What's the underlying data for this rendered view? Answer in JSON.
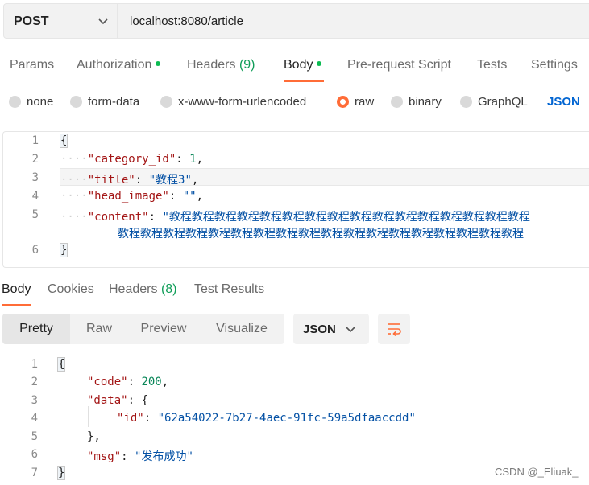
{
  "request": {
    "method": "POST",
    "url": "localhost:8080/article"
  },
  "request_tabs": [
    {
      "label": "Params",
      "dot": false
    },
    {
      "label": "Authorization",
      "dot": true
    },
    {
      "label": "Headers",
      "count": "(9)"
    },
    {
      "label": "Body",
      "dot": true,
      "active": true
    },
    {
      "label": "Pre-request Script"
    },
    {
      "label": "Tests"
    },
    {
      "label": "Settings"
    }
  ],
  "body_types": {
    "options": [
      "none",
      "form-data",
      "x-www-form-urlencoded",
      "raw",
      "binary",
      "GraphQL"
    ],
    "selected": "raw",
    "format": "JSON"
  },
  "request_body": {
    "line_numbers": [
      "1",
      "2",
      "3",
      "4",
      "5",
      "",
      "6"
    ],
    "open_brace": "{",
    "close_brace": "}",
    "fields": [
      {
        "key": "\"category_id\"",
        "value": "1"
      },
      {
        "key": "\"title\"",
        "value": "\"教程3\""
      },
      {
        "key": "\"head_image\"",
        "value": "\"\""
      },
      {
        "key": "\"content\"",
        "value": "\"教程教程教程教程教程教程教程教程教程教程教程教程教程教程教程教程"
      },
      {
        "key": "",
        "value": "教程教程教程教程教程教程教程教程教程教程教程教程教程教程教程教程教程教程"
      }
    ]
  },
  "response_tabs": [
    {
      "label": "Body",
      "active": true
    },
    {
      "label": "Cookies"
    },
    {
      "label": "Headers",
      "count": "(8)"
    },
    {
      "label": "Test Results"
    }
  ],
  "response_view": {
    "modes": [
      "Pretty",
      "Raw",
      "Preview",
      "Visualize"
    ],
    "selected": "Pretty",
    "format": "JSON"
  },
  "response_body": {
    "line_numbers": [
      "1",
      "2",
      "3",
      "4",
      "5",
      "6",
      "7"
    ],
    "lines": [
      {
        "text": "{"
      },
      {
        "key": "\"code\"",
        "value": "200"
      },
      {
        "key": "\"data\"",
        "value": "{"
      },
      {
        "key": "\"id\"",
        "value": "\"62a54022-7b27-4aec-91fc-59a5dfaaccdd\""
      },
      {
        "text": "},"
      },
      {
        "key": "\"msg\"",
        "value": "\"发布成功\""
      },
      {
        "text": "}"
      }
    ]
  },
  "watermark": "CSDN @_Eliuak_",
  "colors": {
    "accent": "#ff6c37",
    "dot_green": "#0cbb52",
    "json_blue": "#0265d2",
    "key_red": "#a31515",
    "string_blue": "#0451a5",
    "number_green": "#098658"
  }
}
